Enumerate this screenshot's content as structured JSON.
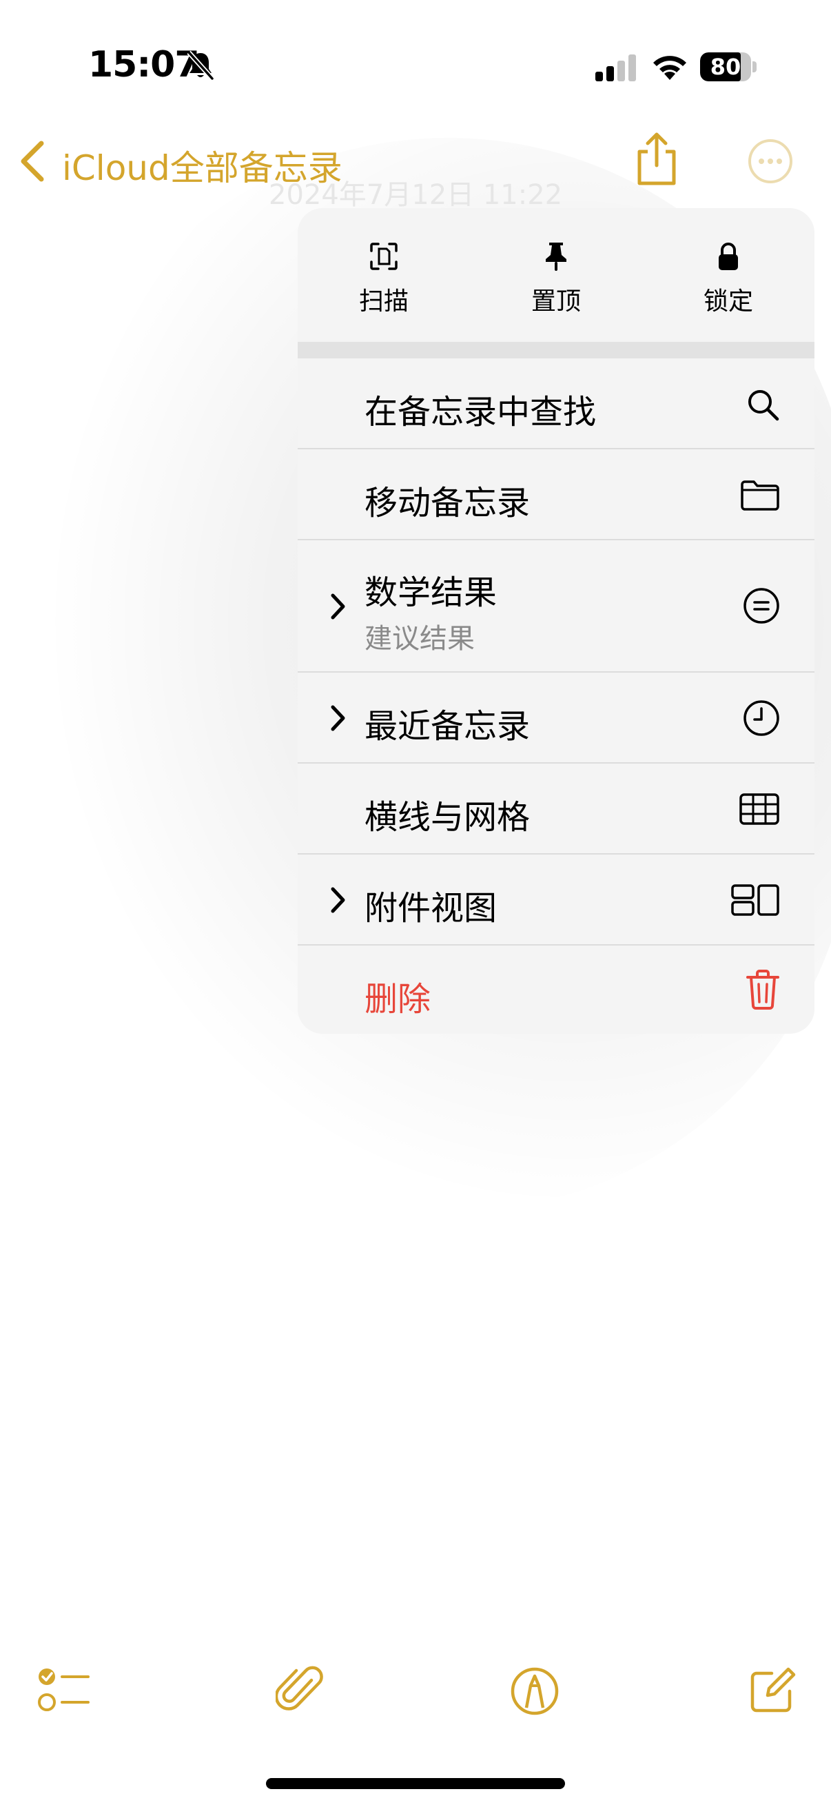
{
  "status_bar": {
    "time": "15:07",
    "battery_level": 80,
    "battery_text": "80"
  },
  "nav": {
    "back_label": "iCloud全部备忘录",
    "faint_date": "2024年7月12日 11:22"
  },
  "menu": {
    "top_actions": [
      {
        "label": "扫描",
        "icon": "scan-icon"
      },
      {
        "label": "置顶",
        "icon": "pin-icon"
      },
      {
        "label": "锁定",
        "icon": "lock-icon"
      }
    ],
    "items": [
      {
        "label": "在备忘录中查找",
        "icon": "search-icon",
        "submenu": false
      },
      {
        "label": "移动备忘录",
        "icon": "folder-icon",
        "submenu": false
      },
      {
        "label": "数学结果",
        "sublabel": "建议结果",
        "icon": "equals-circle-icon",
        "submenu": true
      },
      {
        "label": "最近备忘录",
        "icon": "clock-icon",
        "submenu": true
      },
      {
        "label": "横线与网格",
        "icon": "grid-icon",
        "submenu": false
      },
      {
        "label": "附件视图",
        "icon": "attachment-view-icon",
        "submenu": true
      },
      {
        "label": "删除",
        "icon": "trash-icon",
        "submenu": false,
        "destructive": true
      }
    ]
  },
  "colors": {
    "accent": "#d4a52c",
    "destructive": "#e7463a",
    "menu_bg": "#f4f4f4"
  }
}
